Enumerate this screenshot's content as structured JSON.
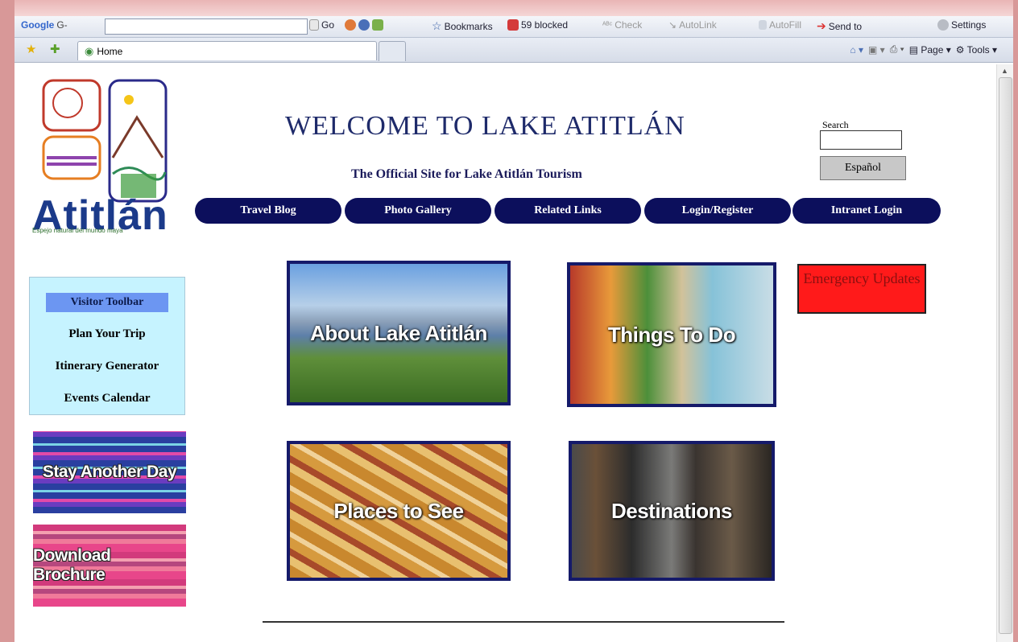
{
  "browser": {
    "google_toolbar": {
      "logo": "Google",
      "search_prefix": "G-",
      "go": "Go",
      "bookmarks": "Bookmarks",
      "blocked": "59 blocked",
      "check": "Check",
      "autolink": "AutoLink",
      "autofill": "AutoFill",
      "send_to": "Send to",
      "settings": "Settings"
    },
    "tab_title": "Home",
    "command_bar": {
      "page": "Page",
      "tools": "Tools"
    }
  },
  "site": {
    "logo_text": "Atitlán",
    "logo_tagline": "Espejo natural del mundo maya",
    "title": "WELCOME TO LAKE ATITLÁN",
    "subtitle": "The Official Site for Lake Atitlán Tourism",
    "search_label": "Search",
    "espanol_button": "Español",
    "nav": [
      "Travel Blog",
      "Photo Gallery",
      "Related Links",
      "Login/Register",
      "Intranet Login"
    ],
    "visitor_toolbar": {
      "heading": "Visitor Toolbar",
      "items": [
        "Plan Your Trip",
        "Itinerary Generator",
        "Events Calendar"
      ]
    },
    "banners": [
      "Stay Another Day",
      "Download Brochure"
    ],
    "tiles": [
      "About Lake Atitlán",
      "Things To Do",
      "Places to See",
      "Destinations"
    ],
    "emergency": "Emergency Updates"
  },
  "colors": {
    "nav_bg": "#0c0f5c",
    "title": "#1e2a6a",
    "visitor_bg": "#c6f3ff",
    "visitor_head": "#6c96f2",
    "emergency_bg": "#ff1a1a"
  }
}
